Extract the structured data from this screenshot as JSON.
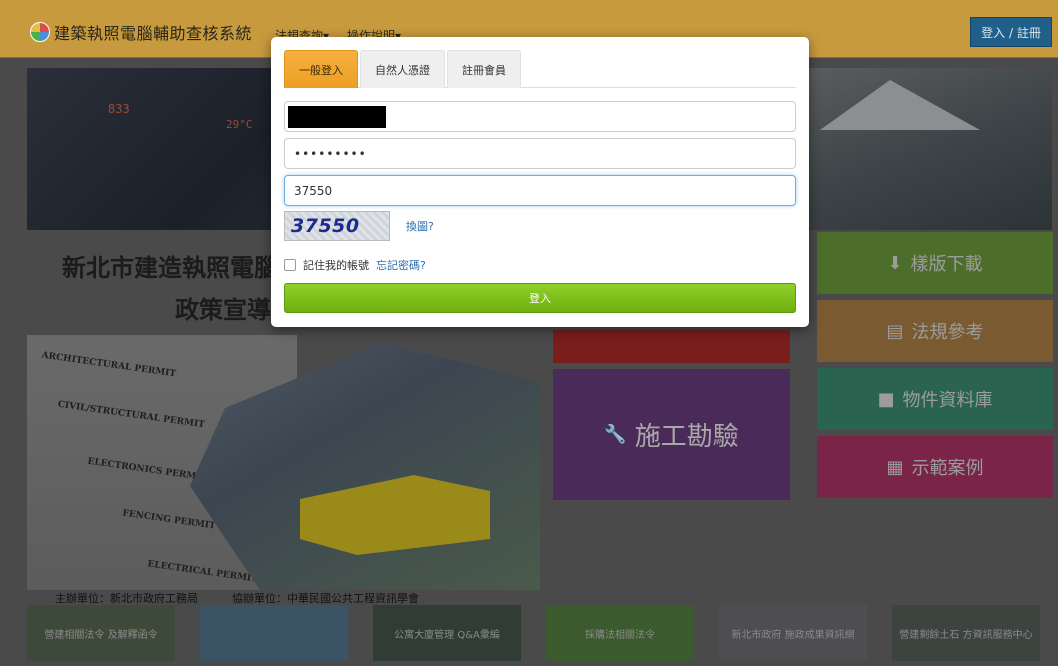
{
  "navbar": {
    "brand": "建築執照電腦輔助查核系統",
    "menu": [
      "法規查詢▾",
      "操作說明▾"
    ],
    "login_label": "登入 / 註冊"
  },
  "background": {
    "clock_left": "833",
    "clock_right": "29°C",
    "title_line1": "新北市建造執照電腦",
    "title_line2": "政策宣導",
    "permits": [
      "ARCHITECTURAL PERMIT",
      "CIVIL/STRUCTURAL PERMIT",
      "ELECTRONICS PERMIT",
      "FENCING PERMIT",
      "ELECTRICAL PERMIT"
    ],
    "tiles": {
      "construction": "施工勘驗",
      "template_download": "樣版下載",
      "regulations": "法規參考",
      "materials": "物件資料庫",
      "examples": "示範案例"
    },
    "sponsor_host": "主辦單位：新北市政府工務局",
    "sponsor_co": "協辦單位：中華民國公共工程資訊學會",
    "banners": [
      "營建相關法令 及解釋函令",
      "",
      "公寓大廈管理 Q&A彙編",
      "採購法相關法令",
      "新北市政府 施政成果資訊網",
      "營建剩餘土石 方資訊服務中心"
    ]
  },
  "modal": {
    "tabs": [
      "一般登入",
      "自然人憑證",
      "註冊會員"
    ],
    "active_tab": 0,
    "password_mask": "•••••••••",
    "captcha_input": "37550",
    "captcha_image_text": "37550",
    "refresh_captcha": "換圖?",
    "remember_label": "記住我的帳號",
    "forgot_password": "忘記密碼?",
    "login_button": "登入"
  }
}
